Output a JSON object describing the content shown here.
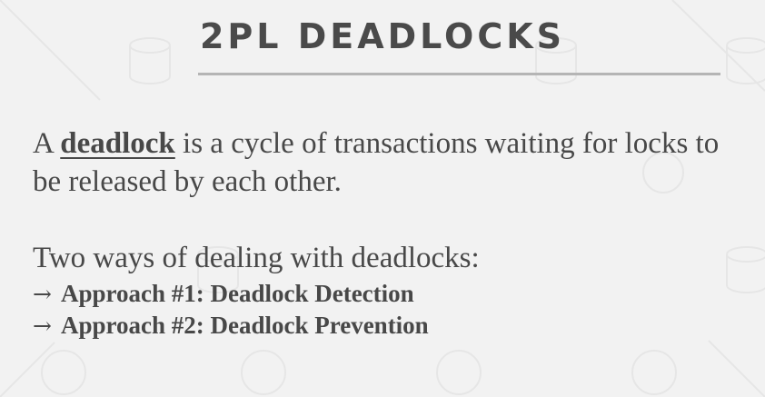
{
  "slide": {
    "title": "2PL DEADLOCKS",
    "definition": {
      "prefix": "A ",
      "keyword": "deadlock",
      "suffix": " is a cycle of transactions waiting for locks to be released by each other."
    },
    "intro": "Two ways of dealing with deadlocks:",
    "bullet_glyph": "→",
    "approaches": [
      "Approach #1: Deadlock Detection",
      "Approach #2: Deadlock Prevention"
    ]
  },
  "colors": {
    "background": "#f2f2f2",
    "text": "#484848",
    "title": "#4a4a4a",
    "rule": "#b5b5b5"
  }
}
